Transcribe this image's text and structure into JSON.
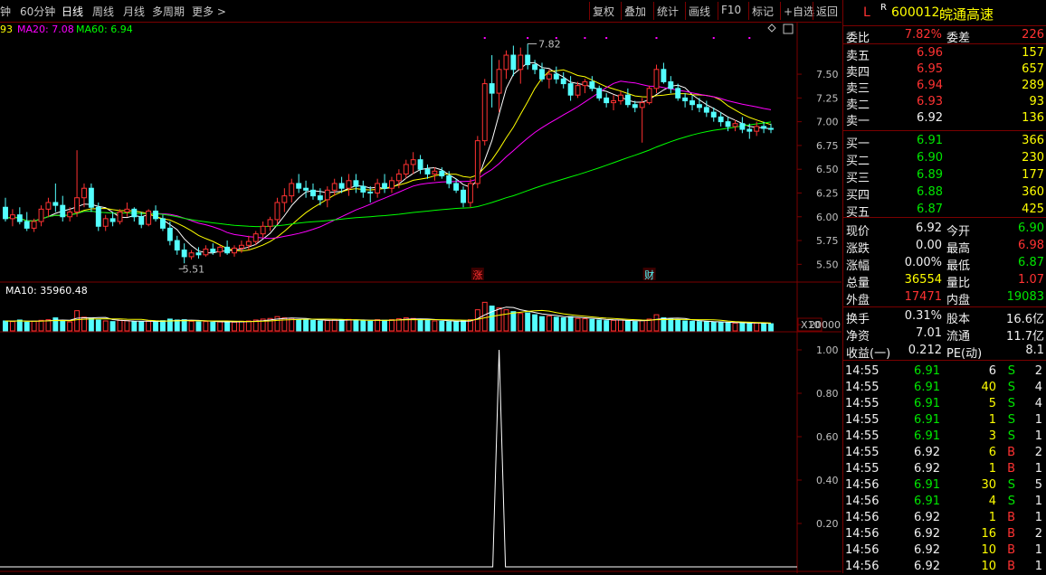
{
  "toolbar": {
    "left": [
      "钟",
      "60分钟",
      "日线",
      "周线",
      "月线",
      "多周期",
      "更多 >"
    ],
    "active": "日线",
    "right": [
      "复权",
      "叠加",
      "统计",
      "画线",
      "F10",
      "标记",
      "+自选",
      "返回"
    ]
  },
  "indicators": {
    "ma_label_cut": "93",
    "ma20": "MA20: 7.08",
    "ma60": "MA60: 6.94",
    "vol_ma": "MA10: 35960.48"
  },
  "chart_data": {
    "type": "candlestick",
    "price_axis": [
      7.5,
      7.25,
      7.0,
      6.75,
      6.5,
      6.25,
      6.0,
      5.75,
      5.5
    ],
    "price_axis_labels": [
      "7.50",
      "7.25",
      "7.00",
      "6.75",
      "6.50",
      "6.25",
      "6.00",
      "5.75",
      "5.50"
    ],
    "price_ylim": [
      5.37,
      7.9
    ],
    "high_label": "7.82",
    "low_label": "5.51",
    "markers": [
      "涨",
      "财"
    ],
    "volume_axis_labels": [
      "20000",
      "X10"
    ],
    "osc_axis": [
      1.0,
      0.8,
      0.6,
      0.4,
      0.2
    ],
    "osc_axis_labels": [
      "1.00",
      "0.80",
      "0.60",
      "0.40",
      "0.20"
    ],
    "osc_peak_index": 69,
    "ohlc": [
      [
        6.1,
        6.2,
        5.95,
        5.98
      ],
      [
        5.98,
        6.08,
        5.9,
        6.02
      ],
      [
        6.02,
        6.1,
        5.92,
        5.95
      ],
      [
        5.95,
        6.05,
        5.85,
        5.88
      ],
      [
        5.88,
        5.98,
        5.84,
        5.95
      ],
      [
        5.95,
        6.12,
        5.9,
        6.08
      ],
      [
        6.08,
        6.2,
        6.0,
        6.15
      ],
      [
        6.15,
        6.35,
        6.05,
        6.12
      ],
      [
        6.12,
        6.22,
        5.95,
        6.0
      ],
      [
        6.0,
        6.1,
        5.95,
        6.05
      ],
      [
        6.05,
        6.7,
        6.0,
        6.2
      ],
      [
        6.2,
        6.35,
        6.1,
        6.3
      ],
      [
        6.3,
        6.35,
        6.05,
        6.1
      ],
      [
        6.1,
        6.15,
        5.85,
        5.9
      ],
      [
        5.9,
        6.02,
        5.85,
        5.98
      ],
      [
        5.98,
        6.05,
        5.9,
        5.95
      ],
      [
        5.95,
        6.08,
        5.92,
        6.05
      ],
      [
        6.05,
        6.15,
        6.0,
        6.08
      ],
      [
        6.08,
        6.1,
        5.95,
        6.0
      ],
      [
        6.0,
        6.05,
        5.88,
        5.92
      ],
      [
        5.92,
        6.08,
        5.9,
        6.06
      ],
      [
        6.06,
        6.12,
        5.95,
        5.98
      ],
      [
        5.98,
        6.02,
        5.85,
        5.88
      ],
      [
        5.88,
        5.95,
        5.7,
        5.75
      ],
      [
        5.75,
        5.8,
        5.6,
        5.65
      ],
      [
        5.65,
        5.72,
        5.51,
        5.58
      ],
      [
        5.58,
        5.65,
        5.55,
        5.62
      ],
      [
        5.62,
        5.68,
        5.56,
        5.6
      ],
      [
        5.6,
        5.7,
        5.58,
        5.66
      ],
      [
        5.66,
        5.72,
        5.6,
        5.63
      ],
      [
        5.63,
        5.7,
        5.58,
        5.68
      ],
      [
        5.68,
        5.75,
        5.6,
        5.62
      ],
      [
        5.62,
        5.7,
        5.58,
        5.67
      ],
      [
        5.67,
        5.75,
        5.62,
        5.7
      ],
      [
        5.7,
        5.8,
        5.65,
        5.74
      ],
      [
        5.74,
        5.85,
        5.7,
        5.82
      ],
      [
        5.82,
        5.95,
        5.78,
        5.9
      ],
      [
        5.9,
        6.0,
        5.85,
        5.97
      ],
      [
        5.97,
        6.2,
        5.92,
        6.15
      ],
      [
        6.15,
        6.3,
        6.05,
        6.22
      ],
      [
        6.22,
        6.4,
        6.15,
        6.35
      ],
      [
        6.35,
        6.45,
        6.25,
        6.3
      ],
      [
        6.3,
        6.38,
        6.2,
        6.28
      ],
      [
        6.28,
        6.35,
        6.18,
        6.22
      ],
      [
        6.22,
        6.3,
        6.12,
        6.18
      ],
      [
        6.18,
        6.32,
        6.1,
        6.28
      ],
      [
        6.28,
        6.4,
        6.22,
        6.35
      ],
      [
        6.35,
        6.42,
        6.25,
        6.3
      ],
      [
        6.3,
        6.45,
        6.22,
        6.38
      ],
      [
        6.38,
        6.45,
        6.25,
        6.32
      ],
      [
        6.32,
        6.38,
        6.2,
        6.26
      ],
      [
        6.26,
        6.32,
        6.15,
        6.25
      ],
      [
        6.25,
        6.4,
        6.2,
        6.35
      ],
      [
        6.35,
        6.45,
        6.25,
        6.3
      ],
      [
        6.3,
        6.42,
        6.25,
        6.38
      ],
      [
        6.38,
        6.5,
        6.3,
        6.45
      ],
      [
        6.45,
        6.6,
        6.4,
        6.55
      ],
      [
        6.55,
        6.68,
        6.45,
        6.6
      ],
      [
        6.6,
        6.65,
        6.45,
        6.5
      ],
      [
        6.5,
        6.55,
        6.4,
        6.45
      ],
      [
        6.45,
        6.52,
        6.38,
        6.48
      ],
      [
        6.48,
        6.52,
        6.4,
        6.43
      ],
      [
        6.43,
        6.48,
        6.3,
        6.35
      ],
      [
        6.35,
        6.4,
        6.25,
        6.28
      ],
      [
        6.28,
        6.32,
        6.1,
        6.15
      ],
      [
        6.15,
        6.4,
        6.1,
        6.35
      ],
      [
        6.35,
        6.85,
        6.3,
        6.8
      ],
      [
        6.8,
        7.45,
        6.75,
        7.4
      ],
      [
        7.4,
        7.7,
        7.15,
        7.3
      ],
      [
        7.3,
        7.65,
        7.1,
        7.55
      ],
      [
        7.55,
        7.75,
        7.45,
        7.7
      ],
      [
        7.7,
        7.8,
        7.48,
        7.55
      ],
      [
        7.55,
        7.78,
        7.4,
        7.7
      ],
      [
        7.7,
        7.82,
        7.55,
        7.6
      ],
      [
        7.6,
        7.65,
        7.5,
        7.55
      ],
      [
        7.55,
        7.62,
        7.42,
        7.45
      ],
      [
        7.45,
        7.55,
        7.35,
        7.5
      ],
      [
        7.5,
        7.58,
        7.4,
        7.45
      ],
      [
        7.45,
        7.52,
        7.35,
        7.4
      ],
      [
        7.4,
        7.48,
        7.22,
        7.28
      ],
      [
        7.28,
        7.42,
        7.25,
        7.38
      ],
      [
        7.38,
        7.45,
        7.3,
        7.42
      ],
      [
        7.42,
        7.48,
        7.32,
        7.35
      ],
      [
        7.35,
        7.38,
        7.22,
        7.25
      ],
      [
        7.25,
        7.3,
        7.15,
        7.2
      ],
      [
        7.2,
        7.28,
        7.12,
        7.22
      ],
      [
        7.22,
        7.32,
        7.18,
        7.28
      ],
      [
        7.28,
        7.35,
        7.15,
        7.18
      ],
      [
        7.18,
        7.22,
        7.1,
        7.15
      ],
      [
        7.15,
        7.25,
        6.78,
        7.2
      ],
      [
        7.2,
        7.38,
        7.18,
        7.35
      ],
      [
        7.35,
        7.6,
        7.3,
        7.55
      ],
      [
        7.55,
        7.62,
        7.4,
        7.42
      ],
      [
        7.42,
        7.48,
        7.3,
        7.35
      ],
      [
        7.35,
        7.4,
        7.22,
        7.25
      ],
      [
        7.25,
        7.3,
        7.15,
        7.22
      ],
      [
        7.22,
        7.28,
        7.12,
        7.18
      ],
      [
        7.18,
        7.25,
        7.1,
        7.15
      ],
      [
        7.15,
        7.22,
        7.05,
        7.1
      ],
      [
        7.1,
        7.15,
        7.0,
        7.05
      ],
      [
        7.05,
        7.1,
        6.95,
        7.0
      ],
      [
        7.0,
        7.05,
        6.9,
        6.95
      ],
      [
        6.95,
        7.02,
        6.9,
        6.98
      ],
      [
        6.98,
        7.05,
        6.88,
        6.92
      ],
      [
        6.92,
        6.98,
        6.82,
        6.9
      ],
      [
        6.9,
        7.0,
        6.85,
        6.95
      ],
      [
        6.95,
        7.0,
        6.88,
        6.93
      ],
      [
        6.93,
        6.98,
        6.88,
        6.92
      ]
    ],
    "volume": [
      3.2,
      3.0,
      3.5,
      2.8,
      3.1,
      3.4,
      3.6,
      4.2,
      3.1,
      2.9,
      6.5,
      4.4,
      4.1,
      3.5,
      3.2,
      3.0,
      3.4,
      3.3,
      3.0,
      2.9,
      3.1,
      3.0,
      3.3,
      3.8,
      3.5,
      3.6,
      3.1,
      2.9,
      3.0,
      2.8,
      2.9,
      3.0,
      2.8,
      3.1,
      3.2,
      3.5,
      3.8,
      4.0,
      4.6,
      4.2,
      4.0,
      3.6,
      3.5,
      3.4,
      3.2,
      3.4,
      3.6,
      3.5,
      3.7,
      3.5,
      3.3,
      3.1,
      3.6,
      3.4,
      3.6,
      3.9,
      4.2,
      4.0,
      3.6,
      3.4,
      3.2,
      3.1,
      3.0,
      2.9,
      3.3,
      3.6,
      6.8,
      9.2,
      8.0,
      7.4,
      6.8,
      6.2,
      5.6,
      5.8,
      5.2,
      4.6,
      4.8,
      4.4,
      4.2,
      4.6,
      4.0,
      3.9,
      3.7,
      3.5,
      3.3,
      3.4,
      3.5,
      3.2,
      3.0,
      3.4,
      3.8,
      5.2,
      4.2,
      3.8,
      3.5,
      3.2,
      3.1,
      3.0,
      2.9,
      2.8,
      2.7,
      2.6,
      2.5,
      2.6,
      2.4,
      2.5,
      2.4,
      2.3
    ]
  },
  "panel": {
    "header": {
      "marker": "L",
      "superscript": "R",
      "code": "600012",
      "name": "皖通高速"
    },
    "committee": {
      "label1": "委比",
      "value1": "7.82%",
      "label2": "委差",
      "value2": "226"
    },
    "asks": [
      {
        "label": "卖五",
        "price": "6.96",
        "vol": "157"
      },
      {
        "label": "卖四",
        "price": "6.95",
        "vol": "657"
      },
      {
        "label": "卖三",
        "price": "6.94",
        "vol": "289"
      },
      {
        "label": "卖二",
        "price": "6.93",
        "vol": "93"
      },
      {
        "label": "卖一",
        "price": "6.92",
        "vol": "136"
      }
    ],
    "bids": [
      {
        "label": "买一",
        "price": "6.91",
        "vol": "366"
      },
      {
        "label": "买二",
        "price": "6.90",
        "vol": "230"
      },
      {
        "label": "买三",
        "price": "6.89",
        "vol": "177"
      },
      {
        "label": "买四",
        "price": "6.88",
        "vol": "360"
      },
      {
        "label": "买五",
        "price": "6.87",
        "vol": "425"
      }
    ],
    "quote": [
      {
        "l1": "现价",
        "v1": "6.92",
        "c1": "wht",
        "l2": "今开",
        "v2": "6.90",
        "c2": "grn"
      },
      {
        "l1": "涨跌",
        "v1": "0.00",
        "c1": "wht",
        "l2": "最高",
        "v2": "6.98",
        "c2": "red"
      },
      {
        "l1": "涨幅",
        "v1": "0.00%",
        "c1": "wht",
        "l2": "最低",
        "v2": "6.87",
        "c2": "grn"
      },
      {
        "l1": "总量",
        "v1": "36554",
        "c1": "yel",
        "l2": "量比",
        "v2": "1.07",
        "c2": "red"
      },
      {
        "l1": "外盘",
        "v1": "17471",
        "c1": "red",
        "l2": "内盘",
        "v2": "19083",
        "c2": "grn"
      }
    ],
    "fund": [
      {
        "l1": "换手",
        "v1": "0.31%",
        "l2": "股本",
        "v2": "16.6亿"
      },
      {
        "l1": "净资",
        "v1": "7.01",
        "l2": "流通",
        "v2": "11.7亿"
      },
      {
        "l1": "收益(一)",
        "v1": "0.212",
        "l2": "PE(动)",
        "v2": "8.1"
      }
    ],
    "ticks": [
      {
        "time": "14:55",
        "price": "6.91",
        "pc": "grn",
        "vol": "6",
        "vc": "wht",
        "side": "S",
        "sc": "grn",
        "n": "2"
      },
      {
        "time": "14:55",
        "price": "6.91",
        "pc": "grn",
        "vol": "40",
        "vc": "yel",
        "side": "S",
        "sc": "grn",
        "n": "4"
      },
      {
        "time": "14:55",
        "price": "6.91",
        "pc": "grn",
        "vol": "5",
        "vc": "yel",
        "side": "S",
        "sc": "grn",
        "n": "4"
      },
      {
        "time": "14:55",
        "price": "6.91",
        "pc": "grn",
        "vol": "1",
        "vc": "yel",
        "side": "S",
        "sc": "grn",
        "n": "1"
      },
      {
        "time": "14:55",
        "price": "6.91",
        "pc": "grn",
        "vol": "3",
        "vc": "yel",
        "side": "S",
        "sc": "grn",
        "n": "1"
      },
      {
        "time": "14:55",
        "price": "6.92",
        "pc": "wht",
        "vol": "6",
        "vc": "yel",
        "side": "B",
        "sc": "red",
        "n": "2"
      },
      {
        "time": "14:55",
        "price": "6.92",
        "pc": "wht",
        "vol": "1",
        "vc": "yel",
        "side": "B",
        "sc": "red",
        "n": "1"
      },
      {
        "time": "14:56",
        "price": "6.91",
        "pc": "grn",
        "vol": "30",
        "vc": "yel",
        "side": "S",
        "sc": "grn",
        "n": "5"
      },
      {
        "time": "14:56",
        "price": "6.91",
        "pc": "grn",
        "vol": "4",
        "vc": "yel",
        "side": "S",
        "sc": "grn",
        "n": "1"
      },
      {
        "time": "14:56",
        "price": "6.92",
        "pc": "wht",
        "vol": "1",
        "vc": "yel",
        "side": "B",
        "sc": "red",
        "n": "1"
      },
      {
        "time": "14:56",
        "price": "6.92",
        "pc": "wht",
        "vol": "16",
        "vc": "yel",
        "side": "B",
        "sc": "red",
        "n": "2"
      },
      {
        "time": "14:56",
        "price": "6.92",
        "pc": "wht",
        "vol": "10",
        "vc": "yel",
        "side": "B",
        "sc": "red",
        "n": "1"
      },
      {
        "time": "14:56",
        "price": "6.92",
        "pc": "wht",
        "vol": "10",
        "vc": "yel",
        "side": "B",
        "sc": "red",
        "n": "1"
      }
    ]
  },
  "colors": {
    "up": "#ff3232",
    "down": "#54ffff",
    "ma5": "#ffffff",
    "ma10": "#ffff00",
    "ma20": "#ff00ff",
    "ma60": "#00ff00",
    "grid": "#7a0000"
  }
}
